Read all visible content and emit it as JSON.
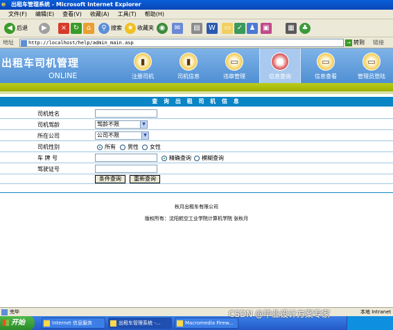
{
  "window": {
    "title": "出租车管理系统 - Microsoft Internet Explorer"
  },
  "menu": [
    "文件(F)",
    "编辑(E)",
    "查看(V)",
    "收藏(A)",
    "工具(T)",
    "帮助(H)"
  ],
  "toolbar": {
    "back": "后退",
    "search": "搜索",
    "favorites": "收藏夹"
  },
  "address": {
    "label": "地址",
    "url": "http://localhost/help/admin_main.asp",
    "go": "转到",
    "links": "链接"
  },
  "site": {
    "brand": "出租车司机管理",
    "brand_sub": "ONLINE",
    "nav": [
      {
        "label": "注册司机",
        "icon": "folder-icon"
      },
      {
        "label": "司机信息",
        "icon": "folder-icon"
      },
      {
        "label": "违章管理",
        "icon": "folder-icon"
      },
      {
        "label": "信息查询",
        "icon": "books-icon"
      },
      {
        "label": "信息查看",
        "icon": "folder-icon"
      },
      {
        "label": "管理员登陆",
        "icon": "folder-icon"
      }
    ],
    "active_nav": "信息查询"
  },
  "form": {
    "header": "查 询 出 租 司 机 信 息",
    "driver_name_label": "司机姓名",
    "driver_age_label": "司机驾龄",
    "age_select": "驾龄不限",
    "company_label": "所在公司",
    "company_select": "公司不限",
    "gender_label": "司机性别",
    "gender_options": [
      "所有",
      "男性",
      "女性"
    ],
    "gender_selected": "所有",
    "plate_label": "车 牌 号",
    "match_options": [
      "精确查询",
      "模糊查询"
    ],
    "match_selected": "精确查询",
    "license_label": "驾驶证号",
    "search_button": "条件查询",
    "reset_button": "重新查询"
  },
  "footer": {
    "company": "秋月出租车有限公司",
    "copyright": "版权所有：沈阳航空工业学院计算机学院 张秋月"
  },
  "status": {
    "text": "完毕",
    "zone": "本地 Intranet"
  },
  "taskbar": {
    "start": "开始",
    "tasks": [
      "Internet 信息服务",
      "出租车管理系统 -...",
      "Macromedia Firew..."
    ]
  },
  "watermark": "CSDN @毕业设计方案专家"
}
